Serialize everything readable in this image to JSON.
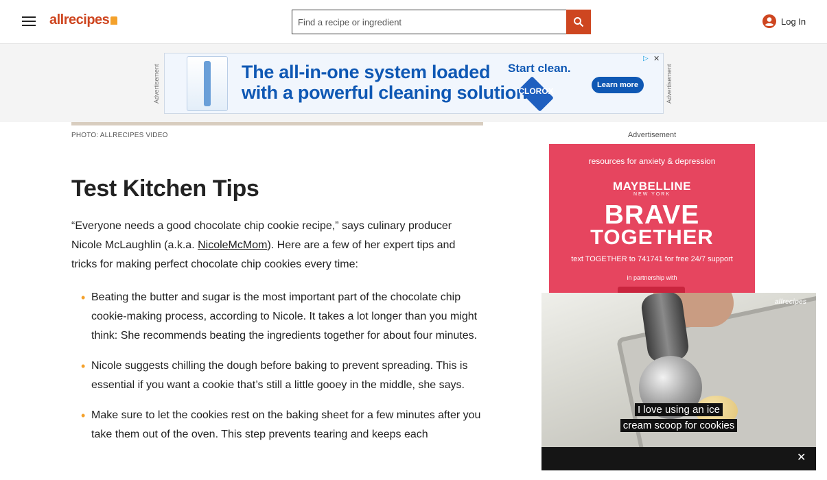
{
  "header": {
    "logo": "allrecipes",
    "search_placeholder": "Find a recipe or ingredient",
    "login_label": "Log In"
  },
  "top_ad": {
    "side_label": "Advertisement",
    "headline_1": "The all-in-one system loaded",
    "headline_2": "with a powerful cleaning solution.",
    "start_clean": "Start clean.",
    "brand": "CLOROX",
    "cta": "Learn more"
  },
  "article": {
    "photo_credit": "PHOTO: ALLRECIPES VIDEO",
    "heading": "Test Kitchen Tips",
    "intro_before": "“Everyone needs a good chocolate chip cookie recipe,” says culinary producer Nicole McLaughlin (a.k.a. ",
    "intro_link": "NicoleMcMom",
    "intro_after": "). Here are a few of her expert tips and tricks for making perfect chocolate chip cookies every time:",
    "tips": [
      "Beating the butter and sugar is the most important part of the chocolate chip cookie-making process, according to Nicole. It takes a lot longer than you might think: She recommends beating the ingredients together for about four minutes.",
      "Nicole suggests chilling the dough before baking to prevent spreading. This is essential if you want a cookie that’s still a little gooey in the middle, she says.",
      "Make sure to let the cookies rest on the baking sheet for a few minutes after you take them out of the oven. This step prevents tearing and keeps each"
    ]
  },
  "side_ad": {
    "label": "Advertisement",
    "line1": "resources for anxiety & depression",
    "brand": "MAYBELLINE",
    "brand_sub": "NEW YORK",
    "big1": "BRAVE",
    "big2": "TOGETHER",
    "line2": "text TOGETHER to 741741 for free 24/7 support",
    "line3": "in partnership with"
  },
  "video": {
    "watermark": "allrecipes",
    "caption_1": "I love using an ice",
    "caption_2": "cream scoop for cookies",
    "close_label": "✕"
  }
}
